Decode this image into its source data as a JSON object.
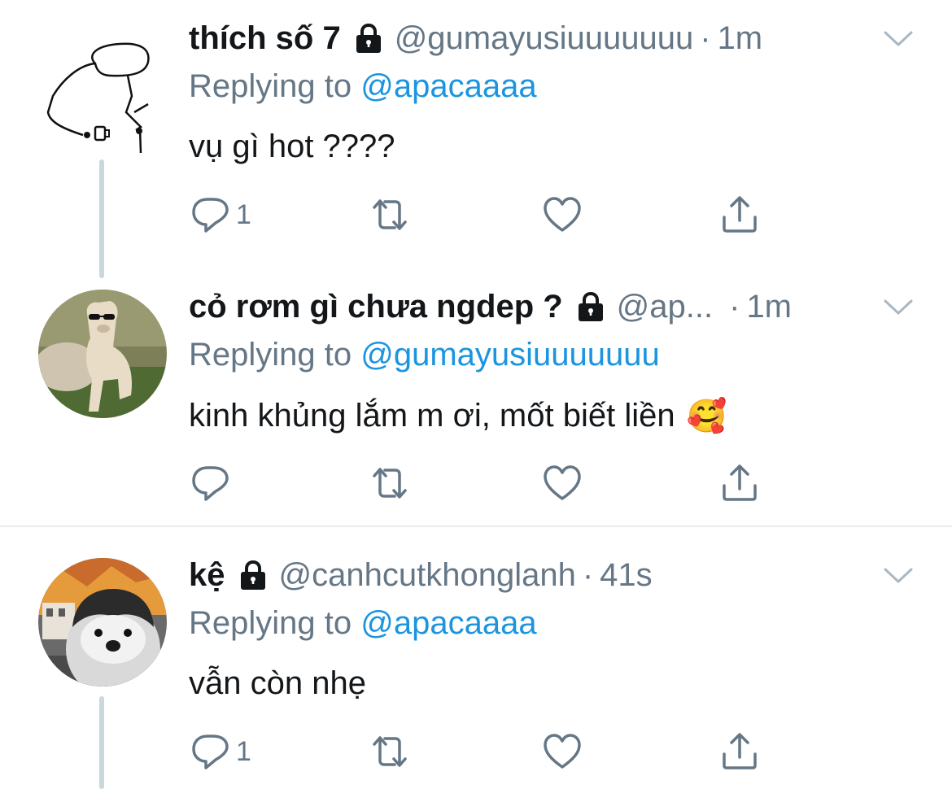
{
  "tweets": [
    {
      "name": "thích số 7",
      "handle": "@gumayusiuuuuuuu",
      "separator": "·",
      "time": "1m",
      "replying_label": "Replying to",
      "replying_to": "@apacaaaa",
      "text": "vụ gì hot ????",
      "reply_count": "1",
      "avatar_icon": "stickman-drawing"
    },
    {
      "name": "cỏ rơm gì chưa ngdep ?",
      "handle": "@ap...",
      "separator": "·",
      "time": "1m",
      "replying_label": "Replying to",
      "replying_to": "@gumayusiuuuuuuu",
      "text": "kinh khủng lắm m ơi, mốt biết liền",
      "emoji": "🥰",
      "reply_count": "",
      "avatar_icon": "alpaca-photo"
    },
    {
      "name": "kệ",
      "handle": "@canhcutkhonglanh",
      "separator": "·",
      "time": "41s",
      "replying_label": "Replying to",
      "replying_to": "@apacaaaa",
      "text": "vẫn còn nhẹ",
      "reply_count": "1",
      "avatar_icon": "penguin-photo"
    }
  ],
  "colors": {
    "link": "#1b95e0",
    "secondary": "#657786",
    "thread_line": "#ccd6dd"
  },
  "icons": [
    "reply-icon",
    "retweet-icon",
    "like-icon",
    "share-icon",
    "lock-icon",
    "chevron-down-icon"
  ]
}
